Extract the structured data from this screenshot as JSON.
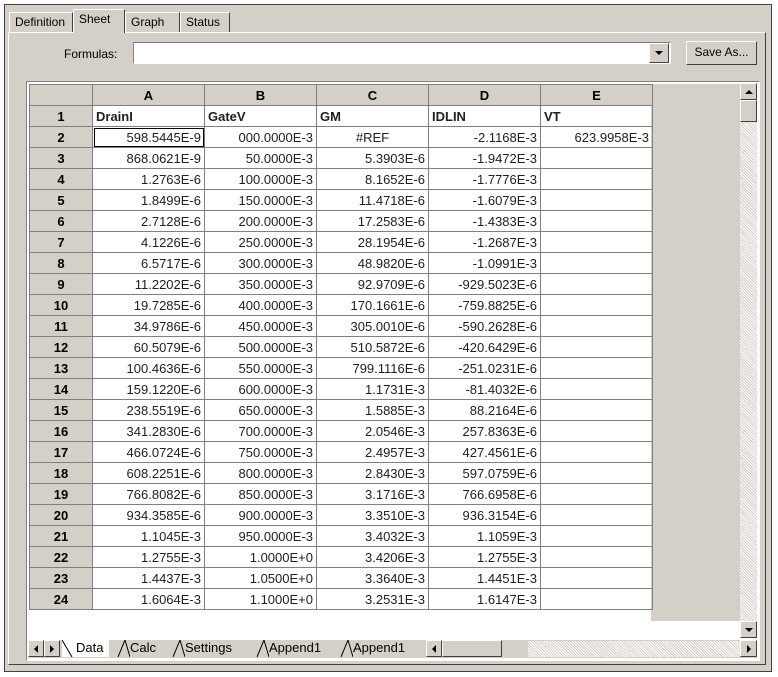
{
  "tabs": [
    "Definition",
    "Sheet",
    "Graph",
    "Status"
  ],
  "active_tab": "Sheet",
  "formulas": {
    "label": "Formulas:",
    "value": ""
  },
  "save_button": "Save As...",
  "columns": [
    "A",
    "B",
    "C",
    "D",
    "E"
  ],
  "rows": [
    [
      "1",
      "DrainI",
      "GateV",
      "GM",
      "IDLIN",
      "VT"
    ],
    [
      "2",
      "598.5445E-9",
      "000.0000E-3",
      "#REF",
      "-2.1168E-3",
      "623.9958E-3"
    ],
    [
      "3",
      "868.0621E-9",
      "50.0000E-3",
      "5.3903E-6",
      "-1.9472E-3",
      ""
    ],
    [
      "4",
      "1.2763E-6",
      "100.0000E-3",
      "8.1652E-6",
      "-1.7776E-3",
      ""
    ],
    [
      "5",
      "1.8499E-6",
      "150.0000E-3",
      "11.4718E-6",
      "-1.6079E-3",
      ""
    ],
    [
      "6",
      "2.7128E-6",
      "200.0000E-3",
      "17.2583E-6",
      "-1.4383E-3",
      ""
    ],
    [
      "7",
      "4.1226E-6",
      "250.0000E-3",
      "28.1954E-6",
      "-1.2687E-3",
      ""
    ],
    [
      "8",
      "6.5717E-6",
      "300.0000E-3",
      "48.9820E-6",
      "-1.0991E-3",
      ""
    ],
    [
      "9",
      "11.2202E-6",
      "350.0000E-3",
      "92.9709E-6",
      "-929.5023E-6",
      ""
    ],
    [
      "10",
      "19.7285E-6",
      "400.0000E-3",
      "170.1661E-6",
      "-759.8825E-6",
      ""
    ],
    [
      "11",
      "34.9786E-6",
      "450.0000E-3",
      "305.0010E-6",
      "-590.2628E-6",
      ""
    ],
    [
      "12",
      "60.5079E-6",
      "500.0000E-3",
      "510.5872E-6",
      "-420.6429E-6",
      ""
    ],
    [
      "13",
      "100.4636E-6",
      "550.0000E-3",
      "799.1116E-6",
      "-251.0231E-6",
      ""
    ],
    [
      "14",
      "159.1220E-6",
      "600.0000E-3",
      "1.1731E-3",
      "-81.4032E-6",
      ""
    ],
    [
      "15",
      "238.5519E-6",
      "650.0000E-3",
      "1.5885E-3",
      "88.2164E-6",
      ""
    ],
    [
      "16",
      "341.2830E-6",
      "700.0000E-3",
      "2.0546E-3",
      "257.8363E-6",
      ""
    ],
    [
      "17",
      "466.0724E-6",
      "750.0000E-3",
      "2.4957E-3",
      "427.4561E-6",
      ""
    ],
    [
      "18",
      "608.2251E-6",
      "800.0000E-3",
      "2.8430E-3",
      "597.0759E-6",
      ""
    ],
    [
      "19",
      "766.8082E-6",
      "850.0000E-3",
      "3.1716E-3",
      "766.6958E-6",
      ""
    ],
    [
      "20",
      "934.3585E-6",
      "900.0000E-3",
      "3.3510E-3",
      "936.3154E-6",
      ""
    ],
    [
      "21",
      "1.1045E-3",
      "950.0000E-3",
      "3.4032E-3",
      "1.1059E-3",
      ""
    ],
    [
      "22",
      "1.2755E-3",
      "1.0000E+0",
      "3.4206E-3",
      "1.2755E-3",
      ""
    ],
    [
      "23",
      "1.4437E-3",
      "1.0500E+0",
      "3.3640E-3",
      "1.4451E-3",
      ""
    ],
    [
      "24",
      "1.6064E-3",
      "1.1000E+0",
      "3.2531E-3",
      "1.6147E-3",
      ""
    ]
  ],
  "sheet_tabs": [
    "Data",
    "Calc",
    "Settings",
    "Append1",
    "Append1"
  ],
  "active_sheet": "Data",
  "colors": {
    "face": "#d4d0c8",
    "shadow": "#808080",
    "dark": "#404040"
  }
}
